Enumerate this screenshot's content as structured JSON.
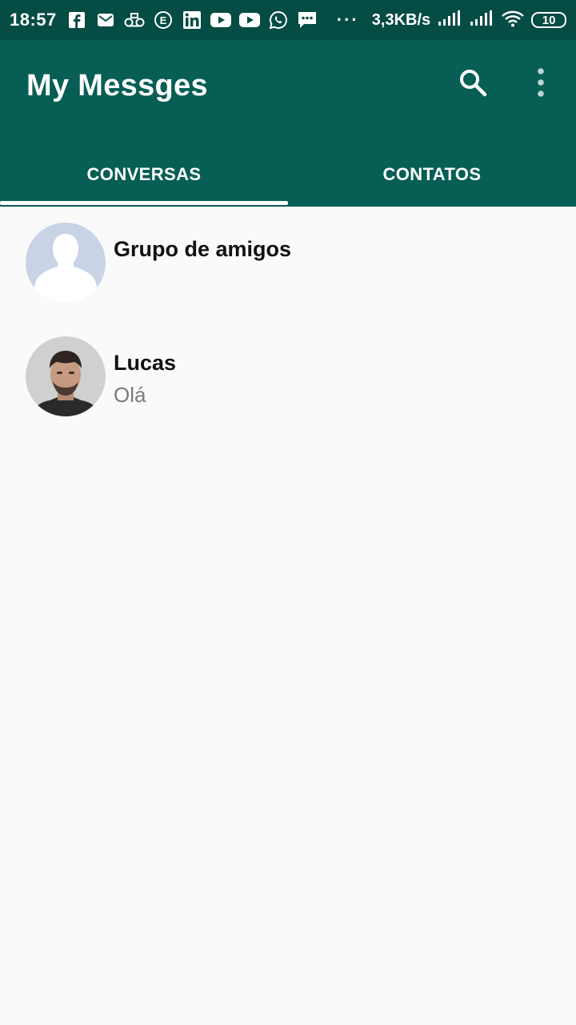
{
  "status_bar": {
    "time": "18:57",
    "icons": [
      "facebook-icon",
      "mail-icon",
      "voicemail-icon",
      "edge-icon",
      "linkedin-icon",
      "youtube-icon",
      "youtube-icon",
      "whatsapp-icon",
      "sms-icon"
    ],
    "more": "···",
    "speed": "3,3KB/s",
    "battery": "10"
  },
  "app_bar": {
    "title": "My Messges",
    "search_icon": "search-icon",
    "menu_icon": "more-vert-icon"
  },
  "tabs": [
    {
      "label": "CONVERSAS",
      "active": true
    },
    {
      "label": "CONTATOS",
      "active": false
    }
  ],
  "conversations": [
    {
      "name": "Grupo de amigos",
      "last_message": "",
      "avatar": "default-avatar"
    },
    {
      "name": "Lucas",
      "last_message": "Olá",
      "avatar": "photo-avatar"
    }
  ],
  "colors": {
    "status_bar": "#054c44",
    "app_bar": "#075e54",
    "background": "#fafafa",
    "tab_indicator": "#ffffff"
  }
}
